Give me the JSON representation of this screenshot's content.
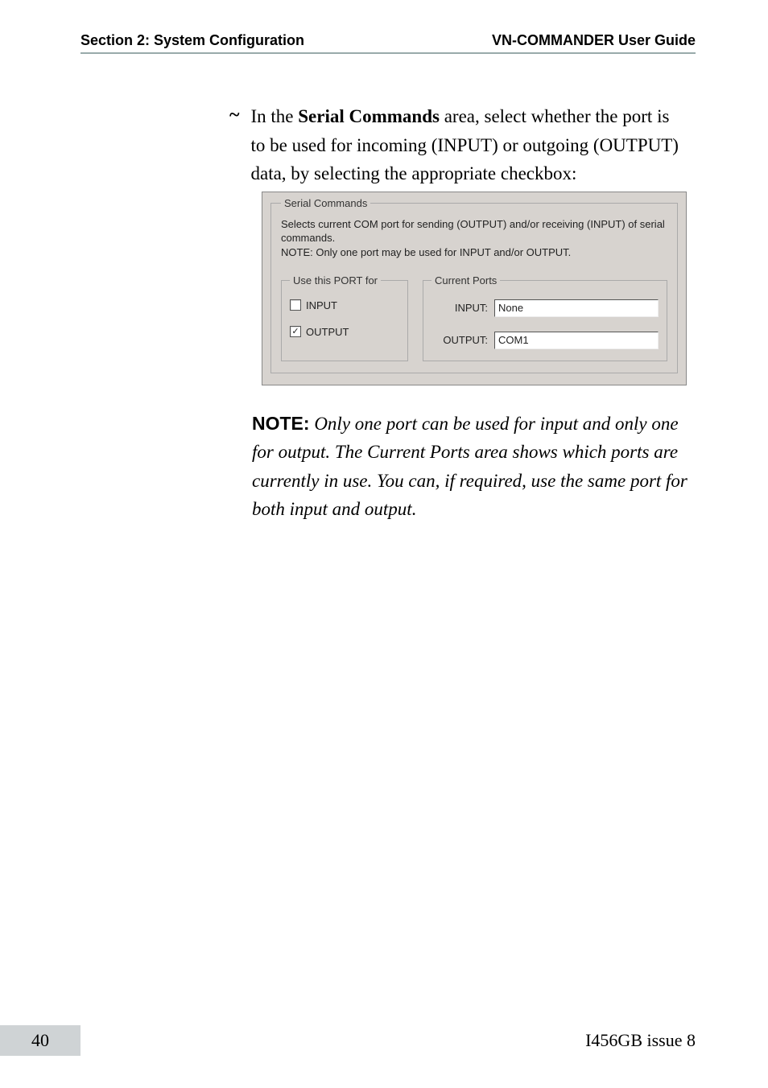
{
  "header": {
    "left": "Section 2: System Configuration",
    "right": "VN-COMMANDER User Guide"
  },
  "bullet": {
    "mark": "~",
    "pre": "In the ",
    "strong": "Serial Commands",
    "post": " area, select whether the port is to be used for incoming (INPUT) or outgoing (OUTPUT) data, by selecting the appropriate checkbox:"
  },
  "dialog": {
    "outer_legend": "Serial Commands",
    "desc_line1": "Selects current COM port for sending (OUTPUT) and/or receiving (INPUT) of serial commands.",
    "desc_line2": "NOTE: Only one port may be used for INPUT and/or OUTPUT.",
    "use_legend": "Use this PORT for",
    "cur_legend": "Current Ports",
    "input_label": "INPUT",
    "output_label": "OUTPUT",
    "input_checked": "",
    "output_checked": "✓",
    "cur_input_label": "INPUT:",
    "cur_output_label": "OUTPUT:",
    "cur_input_value": "None",
    "cur_output_value": "COM1"
  },
  "note": {
    "label": "NOTE:",
    "body": " Only one port can be used for input and only one for output. The Current Ports area shows which ports are currently in use. You can, if required, use the same port for both input and output."
  },
  "footer": {
    "page": "40",
    "issue": "I456GB issue 8"
  }
}
